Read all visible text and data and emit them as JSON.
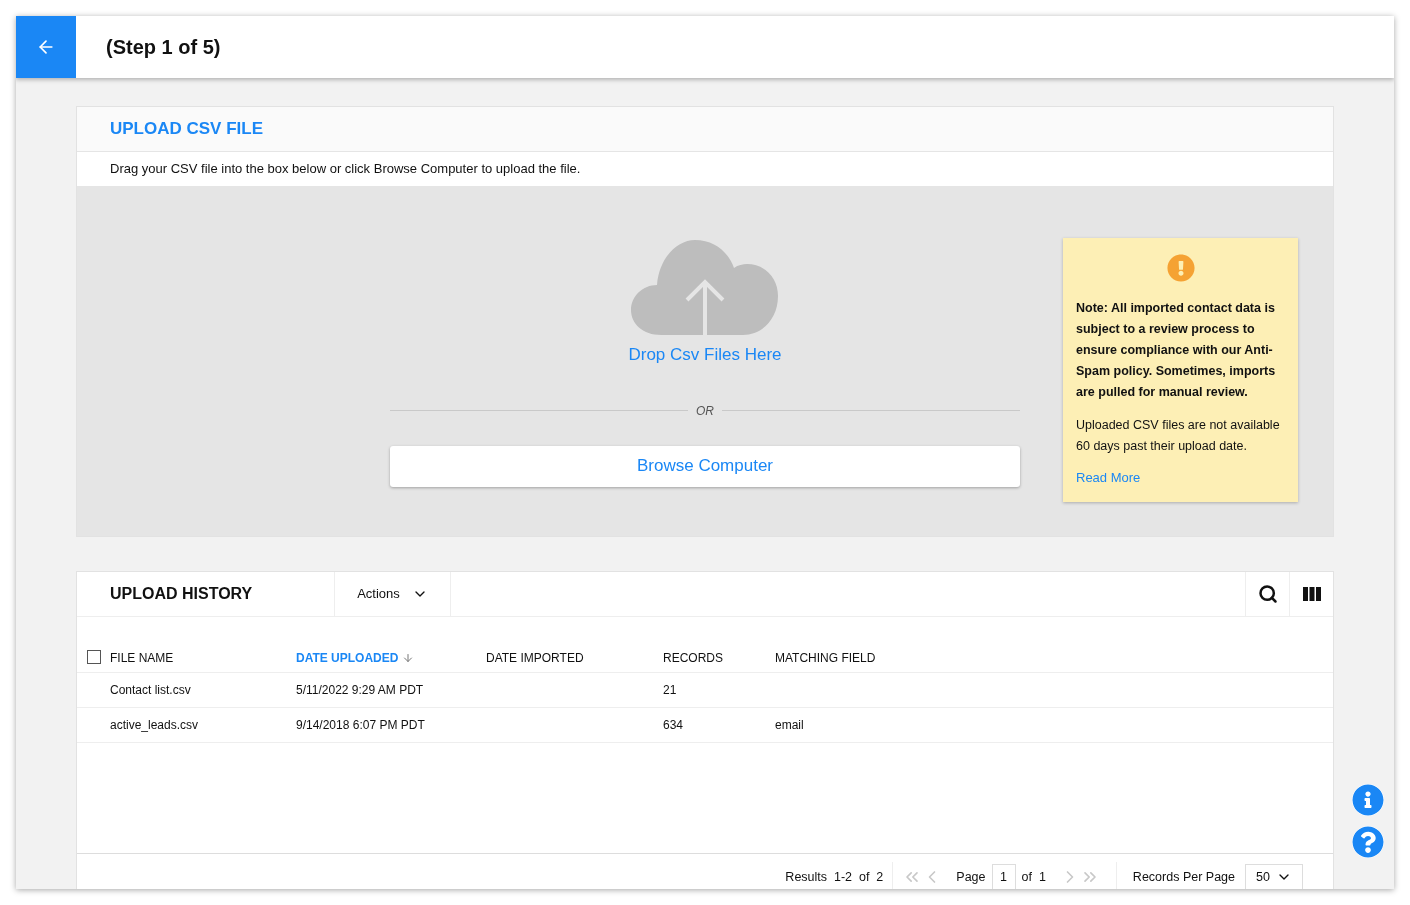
{
  "header": {
    "title": "(Step 1 of 5)"
  },
  "upload": {
    "title": "UPLOAD CSV FILE",
    "instructions": "Drag your CSV file into the box below or click Browse Computer to upload the file.",
    "drop_label": "Drop Csv Files Here",
    "divider_label": "OR",
    "browse_button": "Browse Computer"
  },
  "note": {
    "bold_text": "Note: All imported contact data is subject to a review process to ensure compliance with our Anti-Spam policy. Sometimes, imports are pulled for manual review.",
    "text": "Uploaded CSV files are not available 60 days past their upload date.",
    "link": "Read More"
  },
  "history": {
    "title": "UPLOAD HISTORY",
    "actions": "Actions",
    "select_all_checked": false,
    "columns": [
      {
        "label": "FILE NAME",
        "sorted": false
      },
      {
        "label": "DATE UPLOADED",
        "sorted": true
      },
      {
        "label": "DATE IMPORTED",
        "sorted": false
      },
      {
        "label": "RECORDS",
        "sorted": false
      },
      {
        "label": "MATCHING FIELD",
        "sorted": false
      }
    ],
    "rows": [
      {
        "cells": [
          "Contact list.csv",
          "5/11/2022 9:29 AM PDT",
          "",
          "21",
          ""
        ]
      },
      {
        "cells": [
          "active_leads.csv",
          "9/14/2018 6:07 PM PDT",
          "",
          "634",
          "email"
        ]
      }
    ]
  },
  "footer": {
    "results": "Results  1-2  of  2",
    "page_label": "Page",
    "page_value": "1",
    "of_pages": "of  1",
    "first_disabled": true,
    "prev_disabled": true,
    "next_disabled": true,
    "last_disabled": true,
    "per_page_label": "Records Per Page",
    "per_page_value": "50"
  }
}
